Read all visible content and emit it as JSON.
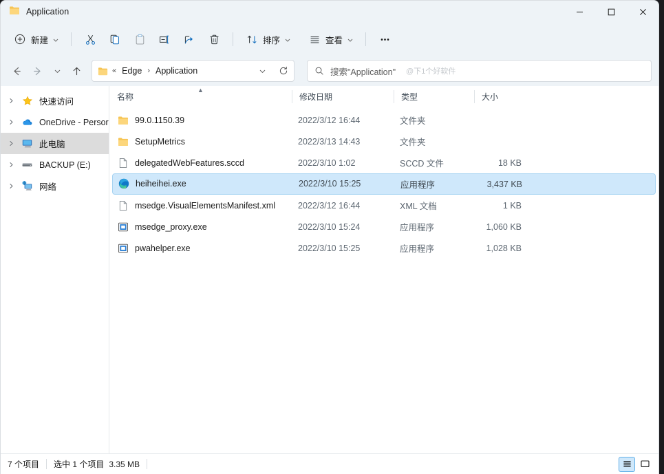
{
  "window": {
    "title": "Application",
    "title_icon": "folder-icon",
    "controls": {
      "minimize": "minimize-icon",
      "maximize": "maximize-icon",
      "close": "close-icon"
    }
  },
  "toolbar": {
    "new_label": "新建",
    "cut_label": "剪切",
    "copy_label": "复制",
    "paste_label": "粘贴",
    "rename_label": "重命名",
    "share_label": "共享",
    "delete_label": "删除",
    "sort_label": "排序",
    "view_label": "查看",
    "more_label": "查看更多"
  },
  "navbar": {
    "back": "back-arrow-icon",
    "forward": "forward-arrow-icon",
    "recent": "chevron-down-icon",
    "up": "up-arrow-icon",
    "address": {
      "icon": "folder-icon",
      "overflow": "«",
      "crumbs": [
        "Edge",
        "Application"
      ],
      "separator": "›",
      "dropdown": "chevron-down-icon",
      "refresh": "refresh-icon"
    },
    "search": {
      "icon": "search-icon",
      "placeholder": "搜索\"Application\"",
      "watermark": "@下1个好软件"
    }
  },
  "sidebar": {
    "items": [
      {
        "label": "快速访问",
        "icon": "star-icon",
        "expandable": true,
        "selected": false
      },
      {
        "label": "OneDrive - Persor",
        "icon": "cloud-icon",
        "expandable": true,
        "selected": false
      },
      {
        "label": "此电脑",
        "icon": "computer-icon",
        "expandable": true,
        "selected": true
      },
      {
        "label": "BACKUP (E:)",
        "icon": "drive-icon",
        "expandable": true,
        "selected": false
      },
      {
        "label": "网络",
        "icon": "network-icon",
        "expandable": true,
        "selected": false
      }
    ]
  },
  "filelist": {
    "columns": [
      {
        "label": "名称",
        "sort": "asc"
      },
      {
        "label": "修改日期",
        "sort": ""
      },
      {
        "label": "类型",
        "sort": ""
      },
      {
        "label": "大小",
        "sort": ""
      }
    ],
    "rows": [
      {
        "name": "99.0.1150.39",
        "date": "2022/3/12 16:44",
        "type": "文件夹",
        "size": "",
        "icon": "folder-icon",
        "selected": false
      },
      {
        "name": "SetupMetrics",
        "date": "2022/3/13 14:43",
        "type": "文件夹",
        "size": "",
        "icon": "folder-icon",
        "selected": false
      },
      {
        "name": "delegatedWebFeatures.sccd",
        "date": "2022/3/10 1:02",
        "type": "SCCD 文件",
        "size": "18 KB",
        "icon": "blank-file-icon",
        "selected": false
      },
      {
        "name": "heiheihei.exe",
        "date": "2022/3/10 15:25",
        "type": "应用程序",
        "size": "3,437 KB",
        "icon": "edge-icon",
        "selected": true
      },
      {
        "name": "msedge.VisualElementsManifest.xml",
        "date": "2022/3/12 16:44",
        "type": "XML 文档",
        "size": "1 KB",
        "icon": "blank-file-icon",
        "selected": false
      },
      {
        "name": "msedge_proxy.exe",
        "date": "2022/3/10 15:24",
        "type": "应用程序",
        "size": "1,060 KB",
        "icon": "app-icon",
        "selected": false
      },
      {
        "name": "pwahelper.exe",
        "date": "2022/3/10 15:25",
        "type": "应用程序",
        "size": "1,028 KB",
        "icon": "app-icon",
        "selected": false
      }
    ]
  },
  "statusbar": {
    "item_count": "7 个项目",
    "selection": "选中 1 个项目",
    "selection_size": "3.35 MB",
    "details_view": "details-view-icon",
    "large_icons_view": "large-icons-view-icon"
  },
  "colors": {
    "chrome": "#eef3f7",
    "selection": "#cfe8fb",
    "selection_border": "#a8d4f2",
    "accent": "#0078d4",
    "folder": "#ffcướng"
  }
}
